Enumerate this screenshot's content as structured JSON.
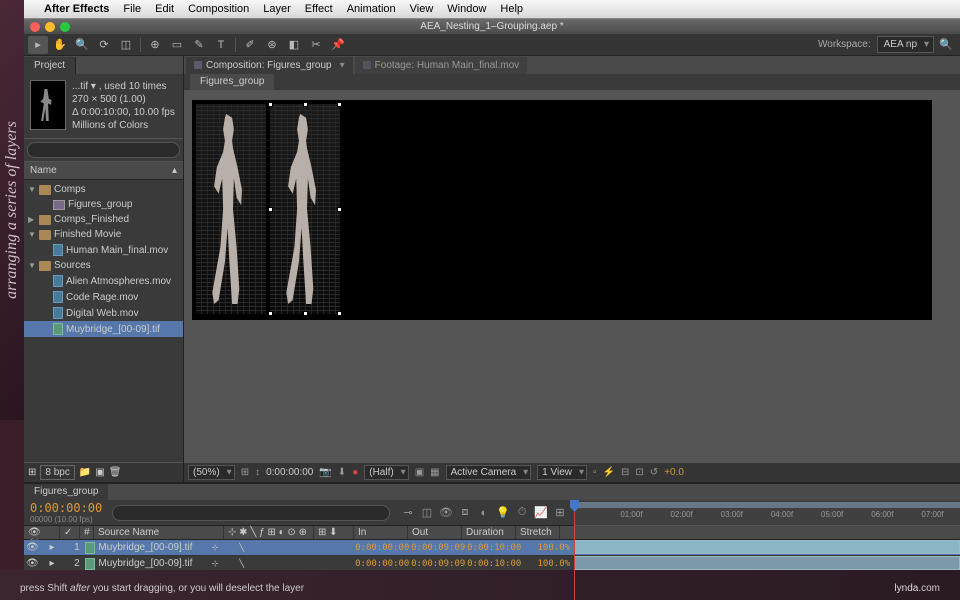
{
  "sidebar_label": "arranging a series of layers",
  "menubar": {
    "apple": "",
    "app": "After Effects",
    "items": [
      "File",
      "Edit",
      "Composition",
      "Layer",
      "Effect",
      "Animation",
      "View",
      "Window",
      "Help"
    ]
  },
  "window_title": "AEA_Nesting_1–Grouping.aep *",
  "workspace": {
    "label": "Workspace:",
    "value": "AEA np"
  },
  "project": {
    "tab": "Project",
    "thumb_info": [
      "...tif ▾ , used 10 times",
      "270 × 500 (1.00)",
      "Δ 0:00:10:00, 10.00 fps",
      "Millions of Colors"
    ],
    "name_header": "Name",
    "tree": [
      {
        "lvl": 0,
        "type": "folder",
        "disc": "▼",
        "label": "Comps"
      },
      {
        "lvl": 1,
        "type": "comp",
        "disc": "",
        "label": "Figures_group"
      },
      {
        "lvl": 0,
        "type": "folder",
        "disc": "▶",
        "label": "Comps_Finished"
      },
      {
        "lvl": 0,
        "type": "folder",
        "disc": "▼",
        "label": "Finished Movie"
      },
      {
        "lvl": 1,
        "type": "mov",
        "disc": "",
        "label": "Human Main_final.mov"
      },
      {
        "lvl": 0,
        "type": "folder",
        "disc": "▼",
        "label": "Sources"
      },
      {
        "lvl": 1,
        "type": "mov",
        "disc": "",
        "label": "Alien Atmospheres.mov"
      },
      {
        "lvl": 1,
        "type": "mov",
        "disc": "",
        "label": "Code Rage.mov"
      },
      {
        "lvl": 1,
        "type": "mov",
        "disc": "",
        "label": "Digital Web.mov"
      },
      {
        "lvl": 1,
        "type": "tif",
        "disc": "",
        "label": "Muybridge_[00-09].tif",
        "sel": true
      }
    ],
    "bpc": "8 bpc"
  },
  "viewer": {
    "tab1": "Composition: Figures_group",
    "tab2": "Footage: Human Main_final.mov",
    "subtab": "Figures_group",
    "footer": {
      "zoom": "(50%)",
      "time": "0:00:00:00",
      "res": "(Half)",
      "camera": "Active Camera",
      "views": "1 View",
      "exposure": "+0.0"
    }
  },
  "timeline": {
    "tab": "Figures_group",
    "timecode": "0:00:00:00",
    "timecode_sub": "00000 (10.00 fps)",
    "ticks": [
      "01:00f",
      "02:00f",
      "03:00f",
      "04:00f",
      "05:00f",
      "06:00f",
      "07:00f"
    ],
    "cols": {
      "source": "Source Name",
      "in": "In",
      "out": "Out",
      "dur": "Duration",
      "str": "Stretch"
    },
    "layers": [
      {
        "num": "1",
        "name": "Muybridge_[00-09].tif",
        "in": "0:00:00:00",
        "out": "0:00:09:09",
        "dur": "0:00:10:00",
        "str": "100.0%",
        "sel": true
      },
      {
        "num": "2",
        "name": "Muybridge_[00-09].tif",
        "in": "0:00:00:00",
        "out": "0:00:09:09",
        "dur": "0:00:10:00",
        "str": "100.0%"
      }
    ]
  },
  "caption": {
    "pre": "press Shift ",
    "em": "after",
    "post": " you start dragging, or you will deselect the layer"
  },
  "brand": {
    "a": "lynda",
    "b": ".com"
  }
}
